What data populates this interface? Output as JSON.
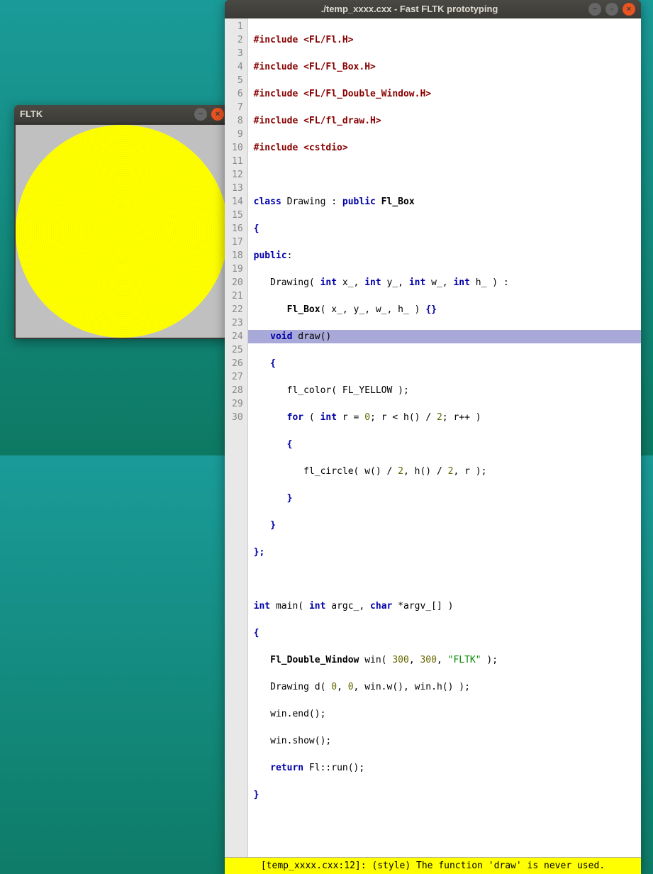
{
  "fltk_window": {
    "title": "FLTK"
  },
  "editor_window": {
    "title": "./temp_xxxx.cxx - Fast FLTK prototyping",
    "highlighted_line": 12,
    "status": "[temp_xxxx.cxx:12]: (style) The function 'draw' is never used.",
    "line_count": 30,
    "code": {
      "l1": "#include <FL/Fl.H>",
      "l2": "#include <FL/Fl_Box.H>",
      "l3": "#include <FL/Fl_Double_Window.H>",
      "l4": "#include <FL/fl_draw.H>",
      "l5": "#include <cstdio>",
      "l6": "",
      "l7_kw_class": "class",
      "l7_name": " Drawing : ",
      "l7_kw_public": "public",
      "l7_base": " Fl_Box",
      "l8": "{",
      "l9_kw": "public",
      "l9_colon": ":",
      "l10_a": "   Drawing( ",
      "l10_int1": "int",
      "l10_b": " x_, ",
      "l10_int2": "int",
      "l10_c": " y_, ",
      "l10_int3": "int",
      "l10_d": " w_, ",
      "l10_int4": "int",
      "l10_e": " h_ ) :",
      "l11_a": "      ",
      "l11_base": "Fl_Box",
      "l11_b": "( x_, y_, w_, h_ ) ",
      "l11_br": "{}",
      "l12_a": "   ",
      "l12_kw": "void",
      "l12_b": " draw()",
      "l13_a": "   ",
      "l13_br": "{",
      "l14_a": "      fl_color( FL_YELLOW );",
      "l15_a": "      ",
      "l15_for": "for",
      "l15_b": " ( ",
      "l15_int": "int",
      "l15_c": " r = ",
      "l15_z": "0",
      "l15_d": "; r < h() / ",
      "l15_two": "2",
      "l15_e": "; r++ )",
      "l16_a": "      ",
      "l16_br": "{",
      "l17_a": "         fl_circle( w() / ",
      "l17_two1": "2",
      "l17_b": ", h() / ",
      "l17_two2": "2",
      "l17_c": ", r );",
      "l18_a": "      ",
      "l18_br": "}",
      "l19_a": "   ",
      "l19_br": "}",
      "l20": "};",
      "l21": "",
      "l22_int": "int",
      "l22_a": " main( ",
      "l22_int2": "int",
      "l22_b": " argc_, ",
      "l22_char": "char",
      "l22_c": " *argv_[] )",
      "l23": "{",
      "l24_a": "   ",
      "l24_type": "Fl_Double_Window",
      "l24_b": " win( ",
      "l24_n1": "300",
      "l24_c": ", ",
      "l24_n2": "300",
      "l24_d": ", ",
      "l24_str": "\"FLTK\"",
      "l24_e": " );",
      "l25_a": "   Drawing d( ",
      "l25_z1": "0",
      "l25_b": ", ",
      "l25_z2": "0",
      "l25_c": ", win.w(), win.h() );",
      "l26": "   win.end();",
      "l27": "   win.show();",
      "l28_a": "   ",
      "l28_ret": "return",
      "l28_b": " Fl::run();",
      "l29": "}",
      "l30": ""
    }
  }
}
